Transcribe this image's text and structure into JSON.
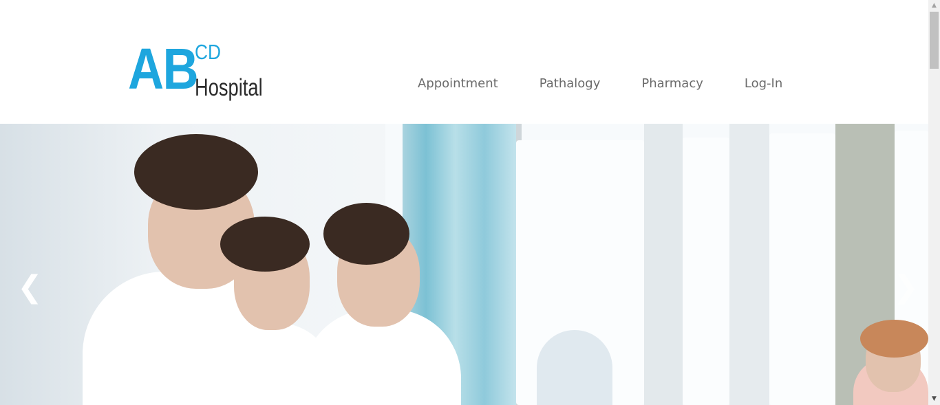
{
  "logo": {
    "ab": "AB",
    "cd": "CD",
    "hospital": "Hospital"
  },
  "nav": {
    "items": [
      {
        "label": "Appointment"
      },
      {
        "label": "Pathalogy"
      },
      {
        "label": "Pharmacy"
      },
      {
        "label": "Log-In"
      }
    ]
  },
  "carousel": {
    "image": "hospital-staff-photo",
    "prev": "❮",
    "next": "❯"
  },
  "colors": {
    "brand_blue": "#1ea6de",
    "nav_text": "#6b6b6b",
    "background": "#ffffff"
  }
}
